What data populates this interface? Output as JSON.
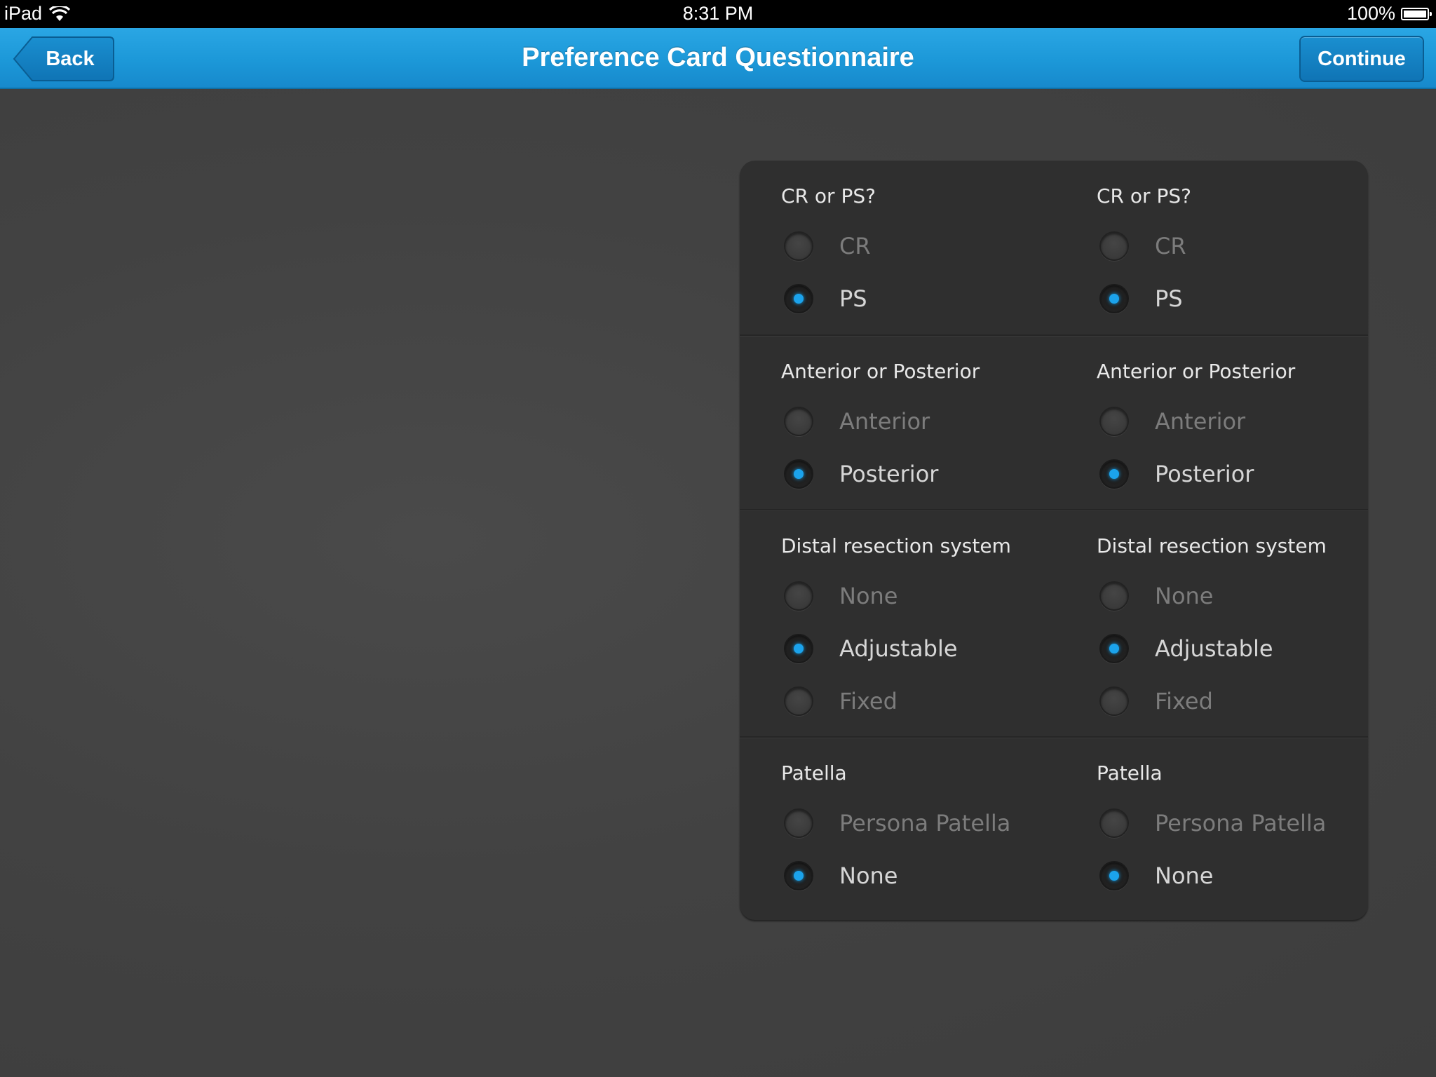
{
  "status_bar": {
    "carrier": "iPad",
    "time": "8:31 PM",
    "battery": "100%"
  },
  "nav": {
    "title": "Preference Card Questionnaire",
    "back_label": "Back",
    "continue_label": "Continue"
  },
  "colors": {
    "nav_blue": "#1c98d8",
    "radio_selected": "#1ba3ec",
    "card_bg": "#2f2f2f"
  },
  "questions": [
    {
      "left": {
        "label": "CR or PS?",
        "options": [
          "CR",
          "PS"
        ],
        "selected": "PS"
      },
      "right": {
        "label": "CR or PS?",
        "options": [
          "CR",
          "PS"
        ],
        "selected": "PS"
      }
    },
    {
      "left": {
        "label": "Anterior or Posterior",
        "options": [
          "Anterior",
          "Posterior"
        ],
        "selected": "Posterior"
      },
      "right": {
        "label": "Anterior or Posterior",
        "options": [
          "Anterior",
          "Posterior"
        ],
        "selected": "Posterior"
      }
    },
    {
      "left": {
        "label": "Distal resection system",
        "options": [
          "None",
          "Adjustable",
          "Fixed"
        ],
        "selected": "Adjustable"
      },
      "right": {
        "label": "Distal resection system",
        "options": [
          "None",
          "Adjustable",
          "Fixed"
        ],
        "selected": "Adjustable"
      }
    },
    {
      "left": {
        "label": "Patella",
        "options": [
          "Persona Patella",
          "None"
        ],
        "selected": "None"
      },
      "right": {
        "label": "Patella",
        "options": [
          "Persona Patella",
          "None"
        ],
        "selected": "None"
      }
    }
  ]
}
